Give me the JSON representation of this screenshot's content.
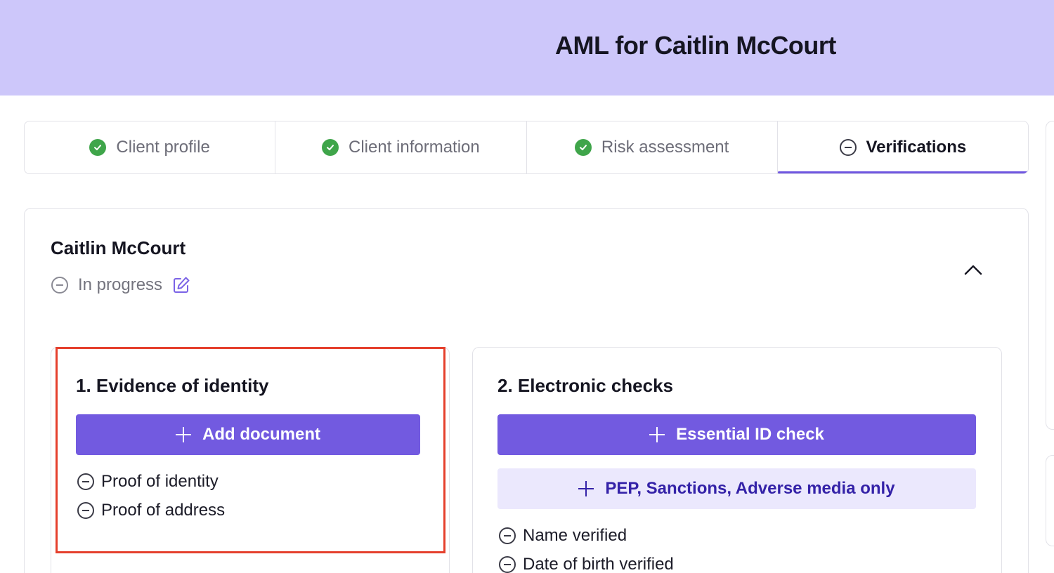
{
  "header": {
    "title": "AML for Caitlin McCourt"
  },
  "tabs": [
    {
      "label": "Client profile",
      "status": "complete"
    },
    {
      "label": "Client information",
      "status": "complete"
    },
    {
      "label": "Risk assessment",
      "status": "complete"
    },
    {
      "label": "Verifications",
      "status": "in-progress",
      "active": true
    }
  ],
  "client": {
    "name": "Caitlin McCourt",
    "status": "In progress"
  },
  "sections": {
    "identity": {
      "title": "1. Evidence of identity",
      "add_button": "Add document",
      "items": [
        "Proof of identity",
        "Proof of address"
      ]
    },
    "electronic": {
      "title": "2. Electronic checks",
      "primary_button": "Essential ID check",
      "secondary_button": "PEP, Sanctions, Adverse media only",
      "items": [
        "Name verified",
        "Date of birth verified"
      ]
    }
  },
  "colors": {
    "header_bg": "#cdc7fa",
    "primary": "#725ae0",
    "secondary_bg": "#ebe8fd",
    "success": "#3fa54a",
    "highlight": "#e5402d"
  }
}
